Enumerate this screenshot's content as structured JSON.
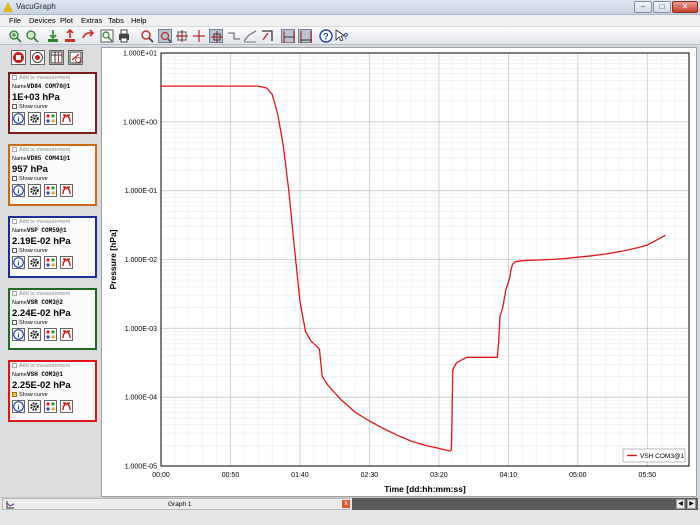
{
  "app": {
    "title": "VacuGraph"
  },
  "window": {
    "minimize": "–",
    "maximize": "□",
    "close": "✕"
  },
  "menu": [
    "File",
    "Devices",
    "Plot",
    "Extras",
    "Tabs",
    "Help"
  ],
  "toolbar": {
    "icons": [
      "zoom-in-icon",
      "zoom-fit-icon",
      "import-icon",
      "export-icon",
      "undo-icon",
      "snapshot-icon",
      "print-icon",
      "magnify-icon",
      "zoom-box-icon",
      "cursor-cross-icon",
      "cursor-cross-alt-icon",
      "crosshair-icon",
      "line-a-icon",
      "line-b-icon",
      "marker-icon",
      "range-a-icon",
      "range-b-icon",
      "help-icon",
      "whats-this-icon"
    ]
  },
  "sidebar": {
    "top_buttons": [
      "stop-icon",
      "rec-icon",
      "table-icon",
      "clear-icon"
    ],
    "sensors": [
      {
        "add_label": "Add to measurement",
        "name_label": "Name:",
        "name": "VD84 COM70@1",
        "value": "1E+03 hPa",
        "show_label": "Show curve",
        "show_checked": false,
        "color": "#7a1d1d"
      },
      {
        "add_label": "Add to measurement",
        "name_label": "Name:",
        "name": "VD85 COM41@1",
        "value": "957 hPa",
        "show_label": "Show curve",
        "show_checked": false,
        "color": "#c96a18"
      },
      {
        "add_label": "Add to measurement",
        "name_label": "Name:",
        "name": "VSP COM59@1",
        "value": "2.19E-02 hPa",
        "show_label": "Show curve",
        "show_checked": false,
        "color": "#1a2f96"
      },
      {
        "add_label": "Add to measurement",
        "name_label": "Name:",
        "name": "VSR COM3@2",
        "value": "2.24E-02 hPa",
        "show_label": "Show curve",
        "show_checked": false,
        "color": "#1d6b22"
      },
      {
        "add_label": "Add to measurement",
        "name_label": "Name:",
        "name": "VSH COM3@1",
        "value": "2.25E-02 hPa",
        "show_label": "Show curve",
        "show_checked": true,
        "color": "#e01515"
      }
    ]
  },
  "chart_data": {
    "type": "line",
    "xlabel": "Time [dd:hh:mm:ss]",
    "ylabel": "Pressure [hPa]",
    "xlim_minutes": [
      0,
      380
    ],
    "x_ticks_labels": [
      "00:00",
      "00:50",
      "01:40",
      "02:30",
      "03:20",
      "04:10",
      "05:00",
      "05:50"
    ],
    "y_scale": "log",
    "ylim": [
      1e-05,
      10
    ],
    "y_ticks_labels": [
      "1.000E-05",
      "1.000E-04",
      "1.000E-03",
      "1.000E-02",
      "1.000E-01",
      "1.000E+00",
      "1.000E+01"
    ],
    "grid": true,
    "legend_position": "bottom-right",
    "series": [
      {
        "name": "VSH COM3@1",
        "color": "#e01515",
        "x_minutes": [
          0,
          20,
          40,
          55,
          70,
          76,
          80,
          84,
          88,
          92,
          96,
          100,
          104,
          108,
          112,
          114,
          116,
          120,
          130,
          140,
          150,
          160,
          170,
          180,
          190,
          200,
          205,
          208,
          209,
          210,
          212,
          213,
          220,
          230,
          240,
          242,
          243,
          244,
          246,
          248,
          251,
          252,
          253,
          255,
          260,
          270,
          280,
          290,
          300,
          310,
          320,
          330,
          340,
          350,
          363
        ],
        "y_hpa": [
          3.3,
          3.3,
          3.3,
          3.3,
          3.3,
          3.1,
          2.5,
          1.3,
          0.45,
          0.1,
          0.015,
          0.0025,
          0.0009,
          0.00065,
          0.00055,
          0.0005,
          0.0002,
          0.00015,
          9e-05,
          6e-05,
          4.5e-05,
          3.5e-05,
          2.8e-05,
          2.3e-05,
          2e-05,
          1.8e-05,
          1.7e-05,
          1.65e-05,
          1.7e-05,
          0.00025,
          0.0003,
          0.00032,
          0.00038,
          0.00038,
          0.00038,
          0.00038,
          0.0006,
          0.0015,
          0.002,
          0.0035,
          0.0055,
          0.0072,
          0.0085,
          0.0093,
          0.0096,
          0.0098,
          0.01,
          0.0103,
          0.0108,
          0.0113,
          0.012,
          0.013,
          0.0143,
          0.0162,
          0.0225
        ]
      }
    ]
  },
  "tabs": {
    "graph_tab": "Graph 1",
    "close": "x",
    "scroll_left": "◀",
    "scroll_right": "▶"
  }
}
